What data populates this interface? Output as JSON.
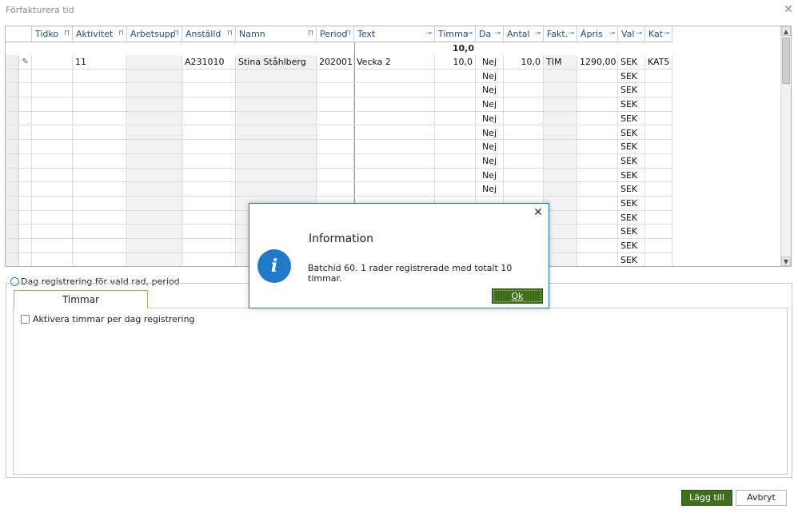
{
  "window": {
    "title": "Förfakturera tid"
  },
  "grid": {
    "columns": [
      {
        "key": "tidko",
        "label": "Tidko"
      },
      {
        "key": "aktivitet",
        "label": "Aktivitet"
      },
      {
        "key": "arbetsupp",
        "label": "Arbetsupp"
      },
      {
        "key": "anstalld",
        "label": "Anställd"
      },
      {
        "key": "namn",
        "label": "Namn"
      },
      {
        "key": "period",
        "label": "Period"
      },
      {
        "key": "text",
        "label": "Text"
      },
      {
        "key": "timma",
        "label": "Timma"
      },
      {
        "key": "da",
        "label": "Da"
      },
      {
        "key": "antal",
        "label": "Antal"
      },
      {
        "key": "fakt",
        "label": "Fakt."
      },
      {
        "key": "apris",
        "label": "Ápris"
      },
      {
        "key": "val",
        "label": "Val"
      },
      {
        "key": "kat",
        "label": "Kat"
      }
    ],
    "summary_timma": "10,0",
    "rows": [
      {
        "tidko": "",
        "aktivitet": "11",
        "arbetsupp": "",
        "anstalld": "A231010",
        "namn": "Stina Ståhlberg",
        "period": "202001",
        "text": "Vecka 2",
        "timma": "10,0",
        "da": "Nej",
        "antal": "10,0",
        "fakt": "TIM",
        "apris": "1290,00",
        "val": "SEK",
        "kat": "KAT5"
      },
      {
        "da": "Nej",
        "val": "SEK"
      },
      {
        "da": "Nej",
        "val": "SEK"
      },
      {
        "da": "Nej",
        "val": "SEK"
      },
      {
        "da": "Nej",
        "val": "SEK"
      },
      {
        "da": "Nej",
        "val": "SEK"
      },
      {
        "da": "Nej",
        "val": "SEK"
      },
      {
        "da": "Nej",
        "val": "SEK"
      },
      {
        "da": "Nej",
        "val": "SEK"
      },
      {
        "da": "Nej",
        "val": "SEK"
      },
      {
        "da": "",
        "val": "SEK"
      },
      {
        "da": "",
        "val": "SEK"
      },
      {
        "da": "",
        "val": "SEK"
      },
      {
        "da": "",
        "val": "SEK"
      },
      {
        "da": "",
        "val": "SEK"
      }
    ]
  },
  "day_registration": {
    "label": "Dag registrering för vald rad, period",
    "tab_label": "Timmar",
    "checkbox_label": "Aktivera timmar per dag registrering",
    "checkbox_checked": false
  },
  "buttons": {
    "add_label": "Lägg till",
    "cancel_label": "Avbryt"
  },
  "dialog": {
    "title": "Information",
    "message": "Batchid 60.  1 rader registrerade med totalt 10 timmar.",
    "ok_label": "Ok",
    "icon": "info-icon"
  },
  "colors": {
    "accent_blue": "#1f7ac8",
    "button_green": "#3f6e1c",
    "tab_border_green": "#8fbf5a",
    "header_text": "#1f4e79"
  }
}
